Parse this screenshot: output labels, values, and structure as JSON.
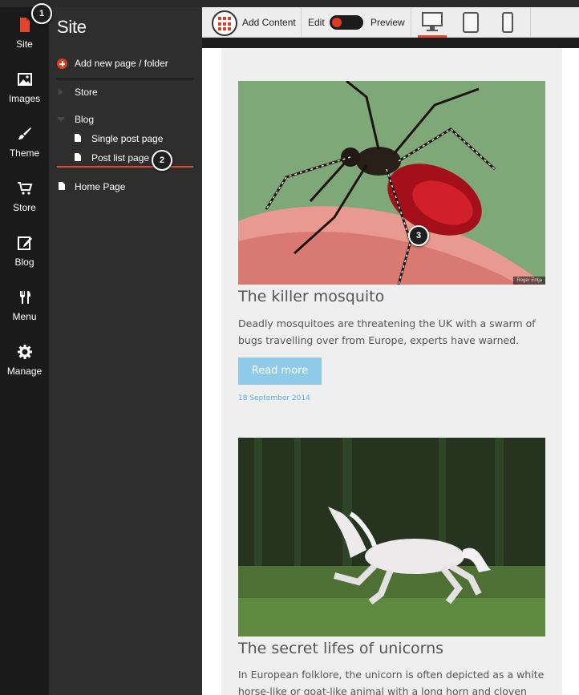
{
  "rail": {
    "items": [
      {
        "label": "Site",
        "icon": "file-icon"
      },
      {
        "label": "Images",
        "icon": "image-icon"
      },
      {
        "label": "Theme",
        "icon": "brush-icon"
      },
      {
        "label": "Store",
        "icon": "cart-icon"
      },
      {
        "label": "Blog",
        "icon": "edit-icon"
      },
      {
        "label": "Menu",
        "icon": "fork-knife-icon"
      },
      {
        "label": "Manage",
        "icon": "gear-icon"
      }
    ]
  },
  "panel": {
    "title": "Site",
    "add_label": "Add new page / folder",
    "tree": {
      "store": "Store",
      "blog": "Blog",
      "single_post": "Single post page",
      "post_list": "Post list page",
      "home": "Home Page"
    }
  },
  "toolbar": {
    "add_content": "Add Content",
    "edit": "Edit",
    "preview": "Preview",
    "active_device": "desktop"
  },
  "posts": [
    {
      "title": "The killer mosquito",
      "excerpt": "Deadly mosquitoes are threatening the UK with a swarm of bugs travelling over from Europe, experts have warned.",
      "button": "Read more",
      "date": "18 September 2014",
      "image_credit": "Roger Eritja"
    },
    {
      "title": "The secret lifes of unicorns",
      "excerpt": "In European folklore, the unicorn is often depicted as a white horse-like or goat-like animal with a long horn and cloven"
    }
  ],
  "callouts": [
    "1",
    "2",
    "3"
  ],
  "colors": {
    "accent": "#e2462b",
    "button": "#8fcbe9",
    "date": "#56b3e2"
  }
}
